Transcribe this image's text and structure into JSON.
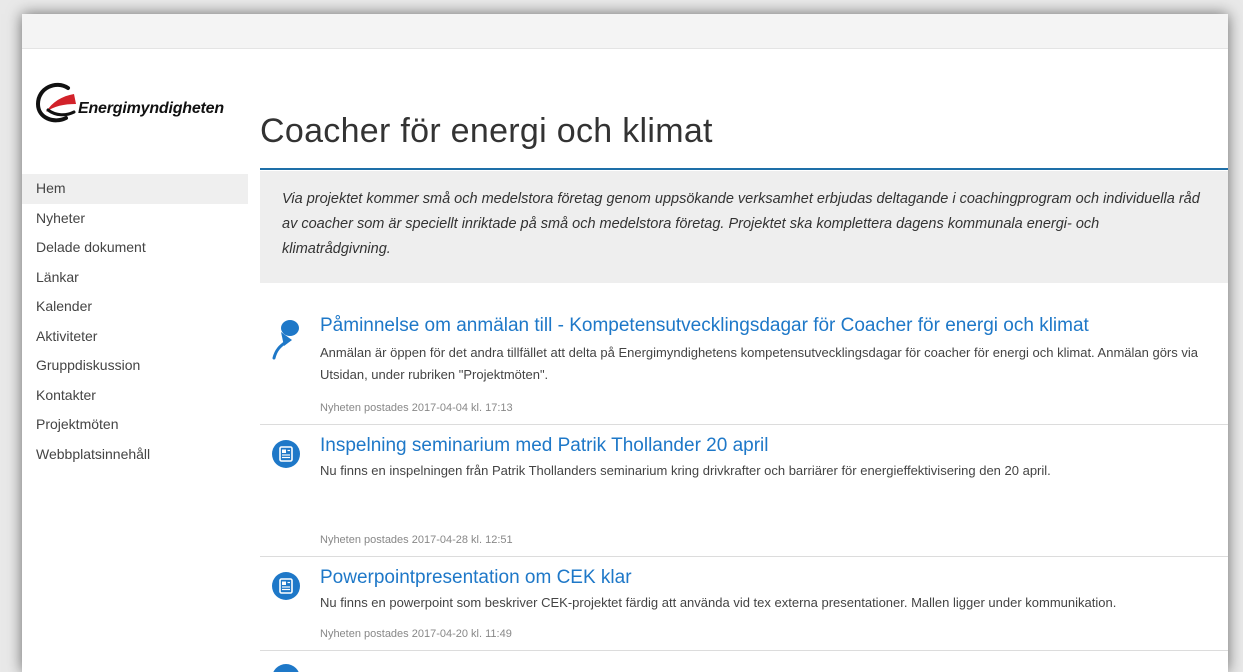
{
  "site": {
    "logo_text": "Energimyndigheten",
    "title": "Coacher för energi och klimat"
  },
  "nav": {
    "items": [
      {
        "label": "Hem",
        "active": true
      },
      {
        "label": "Nyheter"
      },
      {
        "label": "Delade dokument"
      },
      {
        "label": "Länkar"
      },
      {
        "label": "Kalender"
      },
      {
        "label": "Aktiviteter"
      },
      {
        "label": "Gruppdiskussion"
      },
      {
        "label": "Kontakter"
      },
      {
        "label": "Projektmöten"
      },
      {
        "label": "Webbplatsinnehåll"
      }
    ]
  },
  "intro": {
    "text": "Via projektet kommer små och medelstora företag genom uppsökande verksamhet erbjudas deltagande i coachingprogram och individuella råd av coacher som är speciellt inriktade på små och medelstora företag. Projektet ska komplettera dagens kommunala energi- och klimatrådgivning."
  },
  "news": [
    {
      "icon": "pushpin-icon",
      "title": "Påminnelse om anmälan till - Kompetensutvecklingsdagar för Coacher för energi och klimat",
      "body": "Anmälan är öppen för det andra tillfället att delta på Energimyndighetens kompetensutvecklingsdagar för coacher för energi och klimat. Anmälan görs via Utsidan, under rubriken \"Projektmöten\".",
      "meta": "Nyheten postades 2017-04-04 kl. 17:13"
    },
    {
      "icon": "news-article-icon",
      "title": "Inspelning seminarium med Patrik Thollander 20 april",
      "body": "Nu finns en inspelningen från Patrik Thollanders seminarium kring drivkrafter och barriärer för energieffektivisering den 20 april.",
      "meta": "Nyheten postades 2017-04-28 kl. 12:51"
    },
    {
      "icon": "news-article-icon",
      "title": "Powerpointpresentation om CEK klar",
      "body": "Nu finns en powerpoint som beskriver CEK-projektet färdig att använda vid tex externa presentationer. Mallen ligger under kommunikation.",
      "meta": "Nyheten postades 2017-04-20 kl. 11:49"
    }
  ],
  "colors": {
    "accent": "#1e78c8",
    "rule": "#1e6fa8",
    "intro_bg": "#eeeeee"
  }
}
